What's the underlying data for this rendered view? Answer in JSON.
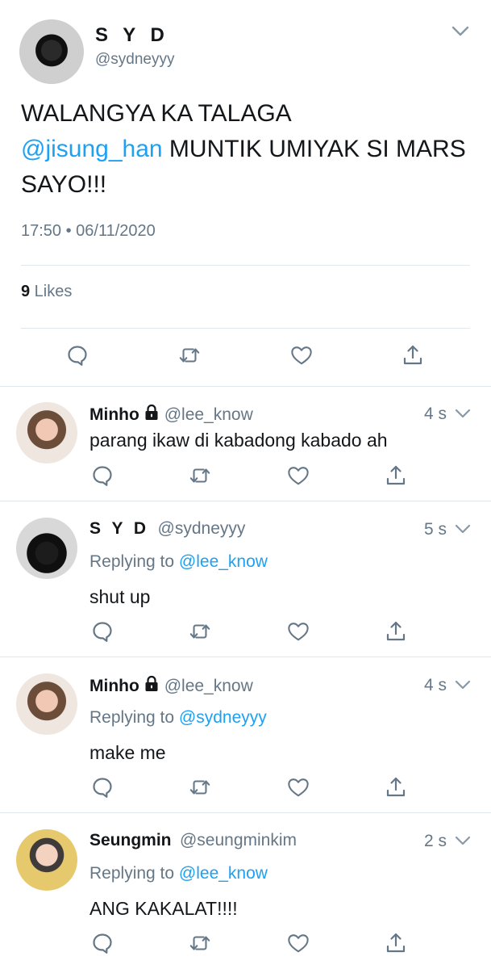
{
  "main_tweet": {
    "name": "S Y D",
    "handle": "@sydneyyy",
    "text_part1": "WALANGYA KA TALAGA",
    "mention": "@jisung_han",
    "text_part2": " MUNTIK UMIYAK SI MARS SAYO!!!",
    "timestamp": "17:50 • 06/11/2020",
    "likes_count": "9",
    "likes_label": " Likes"
  },
  "replies": [
    {
      "name": "Minho",
      "handle": "@lee_know",
      "time": "4 s",
      "locked": true,
      "replying_prefix": "",
      "replying_to": "",
      "text": "parang ikaw di kabadong kabado ah"
    },
    {
      "name": "S Y D",
      "handle": "@sydneyyy",
      "time": "5 s",
      "locked": false,
      "replying_prefix": "Replying to ",
      "replying_to": "@lee_know",
      "text": "shut up"
    },
    {
      "name": "Minho",
      "handle": "@lee_know",
      "time": "4 s",
      "locked": true,
      "replying_prefix": "Replying to ",
      "replying_to": "@sydneyyy",
      "text": "make me"
    },
    {
      "name": "Seungmin",
      "handle": "@seungminkim",
      "time": "2 s",
      "locked": false,
      "replying_prefix": "Replying to ",
      "replying_to": "@lee_know",
      "text": "ANG KAKALAT!!!!"
    }
  ],
  "icons": {
    "reply": "reply-icon",
    "retweet": "retweet-icon",
    "like": "like-icon",
    "share": "share-icon",
    "chevron": "chevron-down-icon",
    "lock": "lock-icon"
  },
  "colors": {
    "accent": "#1da1f2",
    "secondary_text": "#657786",
    "primary_text": "#14171a",
    "divider": "#e1e8ed"
  }
}
